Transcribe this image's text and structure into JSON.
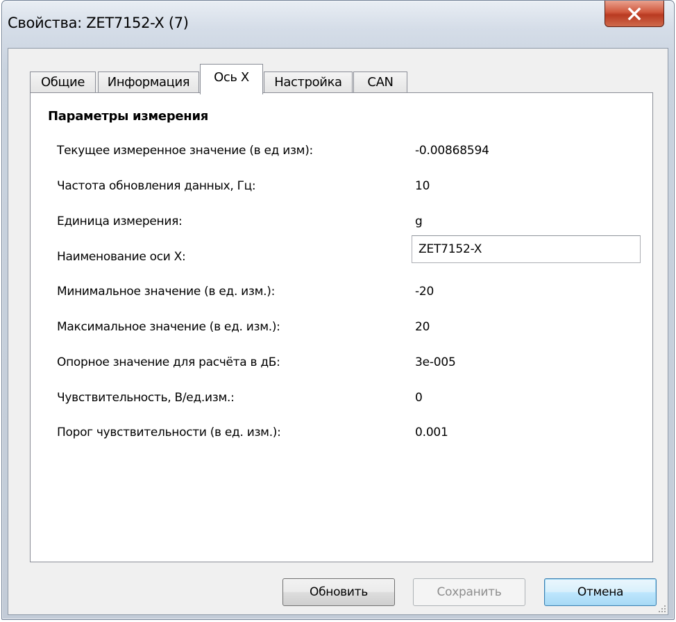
{
  "window": {
    "title": "Свойства: ZET7152-X (7)",
    "close_glyph": "✕"
  },
  "tabs": [
    {
      "label": "Общие",
      "active": false
    },
    {
      "label": "Информация",
      "active": false
    },
    {
      "label": "Ось X",
      "active": true
    },
    {
      "label": "Настройка",
      "active": false
    },
    {
      "label": "CAN",
      "active": false
    }
  ],
  "section": {
    "title": "Параметры измерения"
  },
  "params": [
    {
      "label": "Текущее измеренное значение (в ед изм):",
      "value": "-0.00868594"
    },
    {
      "label": "Частота обновления данных, Гц:",
      "value": "10"
    },
    {
      "label": "Единица измерения:",
      "value": "g"
    },
    {
      "label": "Наименование оси X:",
      "value": "ZET7152-X"
    },
    {
      "label": "Минимальное значение (в ед. изм.):",
      "value": "-20"
    },
    {
      "label": "Максимальное значение (в ед. изм.):",
      "value": "20"
    },
    {
      "label": "Опорное значение для расчёта в дБ:",
      "value": "3e-005"
    },
    {
      "label": "Чувствительность, В/ед.изм.:",
      "value": "0"
    },
    {
      "label": "Порог чувствительности (в ед. изм.):",
      "value": "0.001"
    }
  ],
  "buttons": {
    "refresh": "Обновить",
    "save": "Сохранить",
    "cancel": "Отмена"
  }
}
